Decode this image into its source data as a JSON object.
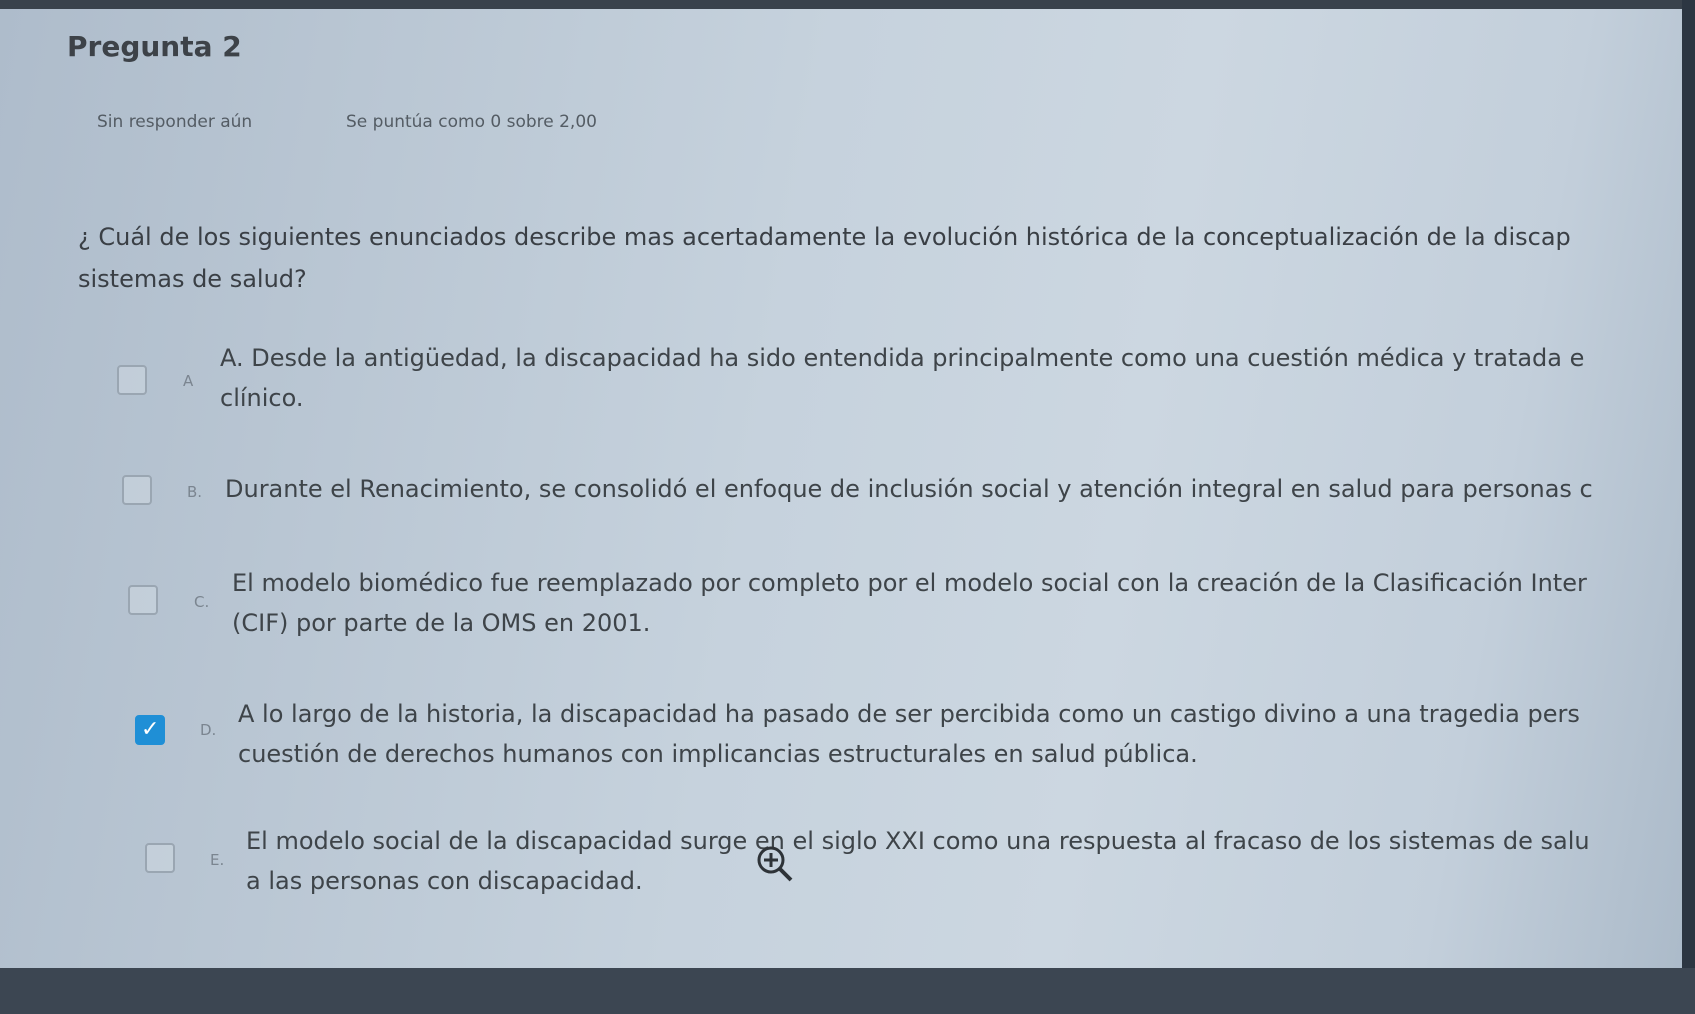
{
  "question_header": {
    "title": "Pregunta 2",
    "status": "Sin responder aún",
    "score": "Se puntúa como 0 sobre 2,00"
  },
  "question": {
    "line1": "¿ Cuál de los siguientes enunciados describe mas acertadamente la evolución histórica de la conceptualización de la discap",
    "line2": "sistemas de salud?"
  },
  "options": [
    {
      "letter": "A",
      "line1": "A. Desde la antigüedad, la discapacidad ha sido entendida principalmente como una cuestión médica y tratada e",
      "line2": "clínico.",
      "checked": false
    },
    {
      "letter": "B.",
      "line1": "Durante el Renacimiento, se consolidó el enfoque de inclusión social y atención integral en salud para personas c",
      "line2": "",
      "checked": false
    },
    {
      "letter": "C.",
      "line1": "El modelo biomédico fue reemplazado por completo por el modelo social con la creación de la Clasificación Inter",
      "line2": "(CIF) por parte de la OMS en 2001.",
      "checked": false
    },
    {
      "letter": "D.",
      "line1": "A lo largo de la historia, la discapacidad ha pasado de ser percibida como un castigo divino a una tragedia pers",
      "line2": "cuestión de derechos humanos con implicancias estructurales en salud pública.",
      "checked": true
    },
    {
      "letter": "E.",
      "line1": "El modelo social de la discapacidad surge en el siglo XXI como una respuesta al fracaso de los sistemas de salu",
      "line2": "a las personas con discapacidad.",
      "checked": false
    }
  ],
  "icons": {
    "zoom": "zoom-in-icon",
    "check": "checkmark-icon"
  },
  "colors": {
    "checked_accent": "#1f8fd6"
  }
}
